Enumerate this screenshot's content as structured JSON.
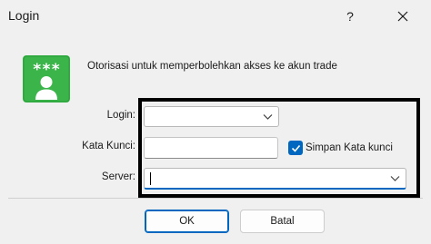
{
  "window": {
    "title": "Login",
    "help_glyph": "?",
    "close_glyph": "✕"
  },
  "header": {
    "icon": "user-password-icon",
    "icon_stars": "***",
    "icon_color": "#3bb54a",
    "description": "Otorisasi untuk memperbolehkan akses ke akun trade"
  },
  "form": {
    "login": {
      "label": "Login:",
      "value": "",
      "icon": "chevron-down-icon"
    },
    "password": {
      "label": "Kata Kunci:",
      "value": ""
    },
    "save_password": {
      "label": "Simpan Kata kunci",
      "checked": true,
      "color": "#0067c0"
    },
    "server": {
      "label": "Server:",
      "value": "",
      "icon": "chevron-down-icon"
    }
  },
  "buttons": {
    "ok_label": "OK",
    "cancel_label": "Batal"
  },
  "highlight_color": "#000000"
}
